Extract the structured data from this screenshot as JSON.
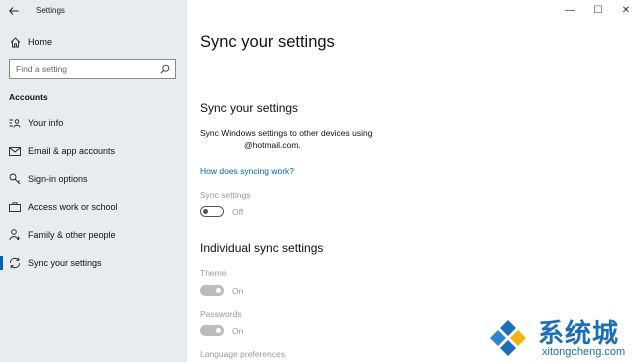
{
  "window": {
    "app_title": "Settings",
    "minimize": "—",
    "maximize": "☐",
    "close": "✕"
  },
  "sidebar": {
    "home_label": "Home",
    "search_placeholder": "Find a setting",
    "section_header": "Accounts",
    "items": [
      {
        "label": "Your info",
        "icon": "person-card-icon"
      },
      {
        "label": "Email & app accounts",
        "icon": "mail-icon"
      },
      {
        "label": "Sign-in options",
        "icon": "key-icon"
      },
      {
        "label": "Access work or school",
        "icon": "briefcase-icon"
      },
      {
        "label": "Family & other people",
        "icon": "person-add-icon"
      },
      {
        "label": "Sync your settings",
        "icon": "sync-icon",
        "selected": true
      }
    ]
  },
  "main": {
    "page_title": "Sync your settings",
    "sync_section": {
      "title": "Sync your settings",
      "description_line1": "Sync Windows settings to other devices using",
      "description_line2": "@hotmail.com.",
      "link": "How does syncing work?",
      "toggle_label": "Sync settings",
      "toggle_state": "Off"
    },
    "individual_section": {
      "title": "Individual sync settings",
      "items": [
        {
          "label": "Theme",
          "state": "On"
        },
        {
          "label": "Passwords",
          "state": "On"
        },
        {
          "label": "Language preferences"
        }
      ]
    }
  },
  "watermark": {
    "text": "系统城",
    "subtext": "xitongcheng.com"
  },
  "colors": {
    "accent": "#0063b1",
    "sidebar_bg": "#e8ecef"
  }
}
